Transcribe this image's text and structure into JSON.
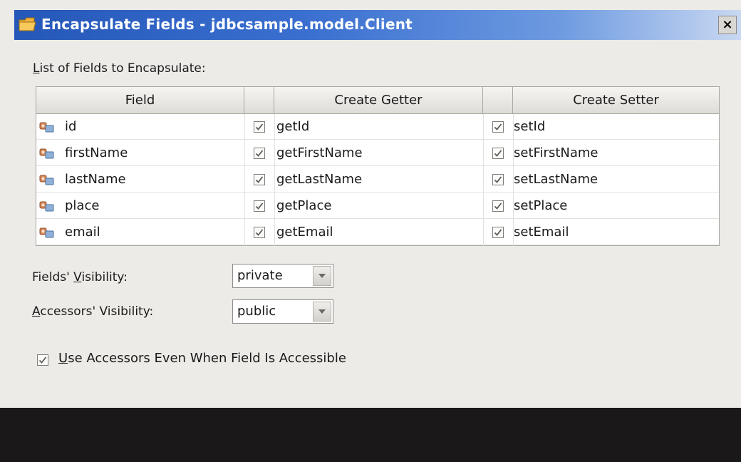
{
  "window": {
    "title": "Encapsulate Fields - jdbcsample.model.Client",
    "close_symbol": "×"
  },
  "table": {
    "label": "List of Fields to Encapsulate:",
    "columns": [
      "Field",
      "",
      "Create Getter",
      "",
      "Create Setter"
    ],
    "rows": [
      {
        "field": "id",
        "getter_checked": true,
        "getter": "getId",
        "setter_checked": true,
        "setter": "setId"
      },
      {
        "field": "firstName",
        "getter_checked": true,
        "getter": "getFirstName",
        "setter_checked": true,
        "setter": "setFirstName"
      },
      {
        "field": "lastName",
        "getter_checked": true,
        "getter": "getLastName",
        "setter_checked": true,
        "setter": "setLastName"
      },
      {
        "field": "place",
        "getter_checked": true,
        "getter": "getPlace",
        "setter_checked": true,
        "setter": "setPlace"
      },
      {
        "field": "email",
        "getter_checked": true,
        "getter": "getEmail",
        "setter_checked": true,
        "setter": "setEmail"
      }
    ]
  },
  "fields_visibility": {
    "label": "Fields' Visibility:",
    "value": "private"
  },
  "accessors_visibility": {
    "label": "Accessors' Visibility:",
    "value": "public"
  },
  "use_accessors": {
    "label": "Use Accessors Even When Field Is Accessible",
    "checked": true
  },
  "icons": {
    "title": "folder-icon",
    "field": "field-icon",
    "check": "checkmark-icon",
    "dropdown": "dropdown-arrow-icon"
  },
  "colors": {
    "titlebar_start": "#2557b8",
    "titlebar_end": "#c9d8f2",
    "dialog_bg": "#ecebe7",
    "bottom_bar": "#1a1818"
  }
}
